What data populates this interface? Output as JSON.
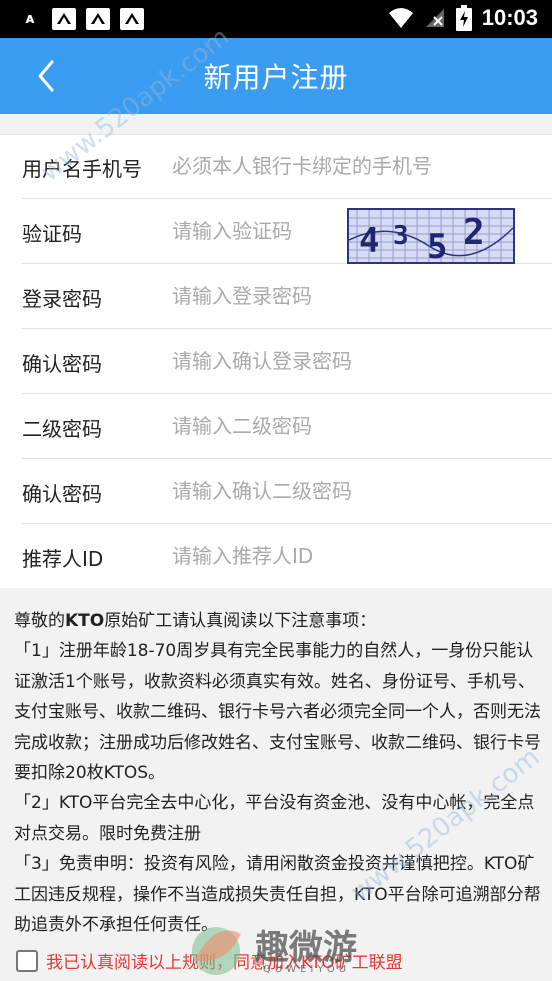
{
  "status_bar": {
    "left_icons": [
      "notification-a-icon",
      "app-icon",
      "app-icon",
      "app-icon"
    ],
    "time": "10:03"
  },
  "header": {
    "title": "新用户注册"
  },
  "form": {
    "rows": [
      {
        "label": "用户名手机号",
        "placeholder": "必须本人银行卡绑定的手机号"
      },
      {
        "label": "验证码",
        "placeholder": "请输入验证码"
      },
      {
        "label": "登录密码",
        "placeholder": "请输入登录密码"
      },
      {
        "label": "确认密码",
        "placeholder": "请输入确认登录密码"
      },
      {
        "label": "二级密码",
        "placeholder": "请输入二级密码"
      },
      {
        "label": "确认密码",
        "placeholder": "请输入确认二级密码"
      },
      {
        "label": "推荐人ID",
        "placeholder": "请输入推荐人ID"
      }
    ],
    "captcha_text": "4352"
  },
  "notice": {
    "intro_prefix": "尊敬的",
    "intro_brand": "KTO",
    "intro_suffix": "原始矿工请认真阅读以下注意事项：",
    "p1": "「1」注册年龄18-70周岁具有完全民事能力的自然人，一身份只能认证激活1个账号，收款资料必须真实有效。姓名、身份证号、手机号、支付宝账号、收款二维码、银行卡号六者必须完全同一个人，否则无法完成收款；注册成功后修改姓名、支付宝账号、收款二维码、银行卡号要扣除20枚KTOS。",
    "p2": "「2」KTO平台完全去中心化，平台没有资金池、没有中心帐，完全点对点交易。限时免费注册",
    "p3": "「3」免责申明：投资有风险，请用闲散资金投资并谨慎把控。KTO矿工因违反规程，操作不当造成损失责任自担，KTO平台除可追溯部分帮助追责外不承担任何责任。"
  },
  "agreement": {
    "text": "我已认真阅读以上规则，同意加入KTO矿工联盟"
  },
  "watermark": {
    "site": "www.520apk.com",
    "logo_main": "趣微游",
    "logo_sub": "QUWEIYOU"
  },
  "colors": {
    "header_blue": "#3a9cf0",
    "agree_red": "#e53935"
  }
}
